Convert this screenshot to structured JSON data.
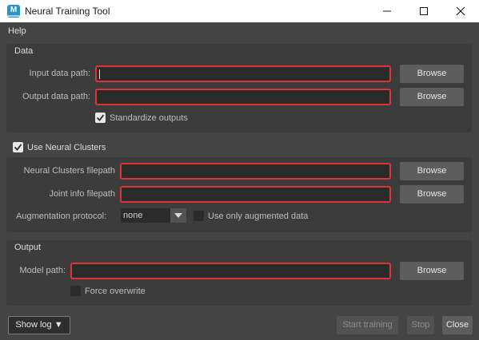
{
  "window": {
    "title": "Neural Training Tool",
    "app_icon_letter": "M"
  },
  "menu": {
    "items": [
      "Help"
    ]
  },
  "data_section": {
    "title": "Data",
    "input_label": "Input data path:",
    "input_value": "",
    "output_label": "Output data path:",
    "output_value": "",
    "browse_label": "Browse",
    "standardize_label": "Standardize outputs",
    "standardize_checked": true
  },
  "clusters_section": {
    "toggle_label": "Use Neural Clusters",
    "toggle_checked": true,
    "clusters_label": "Neural Clusters filepath",
    "clusters_value": "",
    "joint_label": "Joint info filepath",
    "joint_value": "",
    "browse_label": "Browse",
    "augmentation_label": "Augmentation protocol:",
    "augmentation_value": "none",
    "augmented_only_label": "Use only augmented data",
    "augmented_only_checked": false
  },
  "output_section": {
    "title": "Output",
    "model_label": "Model path:",
    "model_value": "",
    "browse_label": "Browse",
    "overwrite_label": "Force overwrite",
    "overwrite_checked": false
  },
  "footer": {
    "show_log_label": "Show log ▼",
    "start_label": "Start training",
    "stop_label": "Stop",
    "close_label": "Close"
  },
  "colors": {
    "background": "#444444",
    "section_bg": "#3c3c3c",
    "field_bg": "#2b2b2b",
    "error_border": "#e03333",
    "button_bg": "#5d5d5d",
    "app_icon": "#2a93c9"
  },
  "icons": {
    "app": "maya-app-icon",
    "minimize": "minimize-icon",
    "maximize": "maximize-icon",
    "close": "close-icon",
    "checkmark": "checkmark-icon",
    "dropdown": "chevron-down-icon"
  }
}
